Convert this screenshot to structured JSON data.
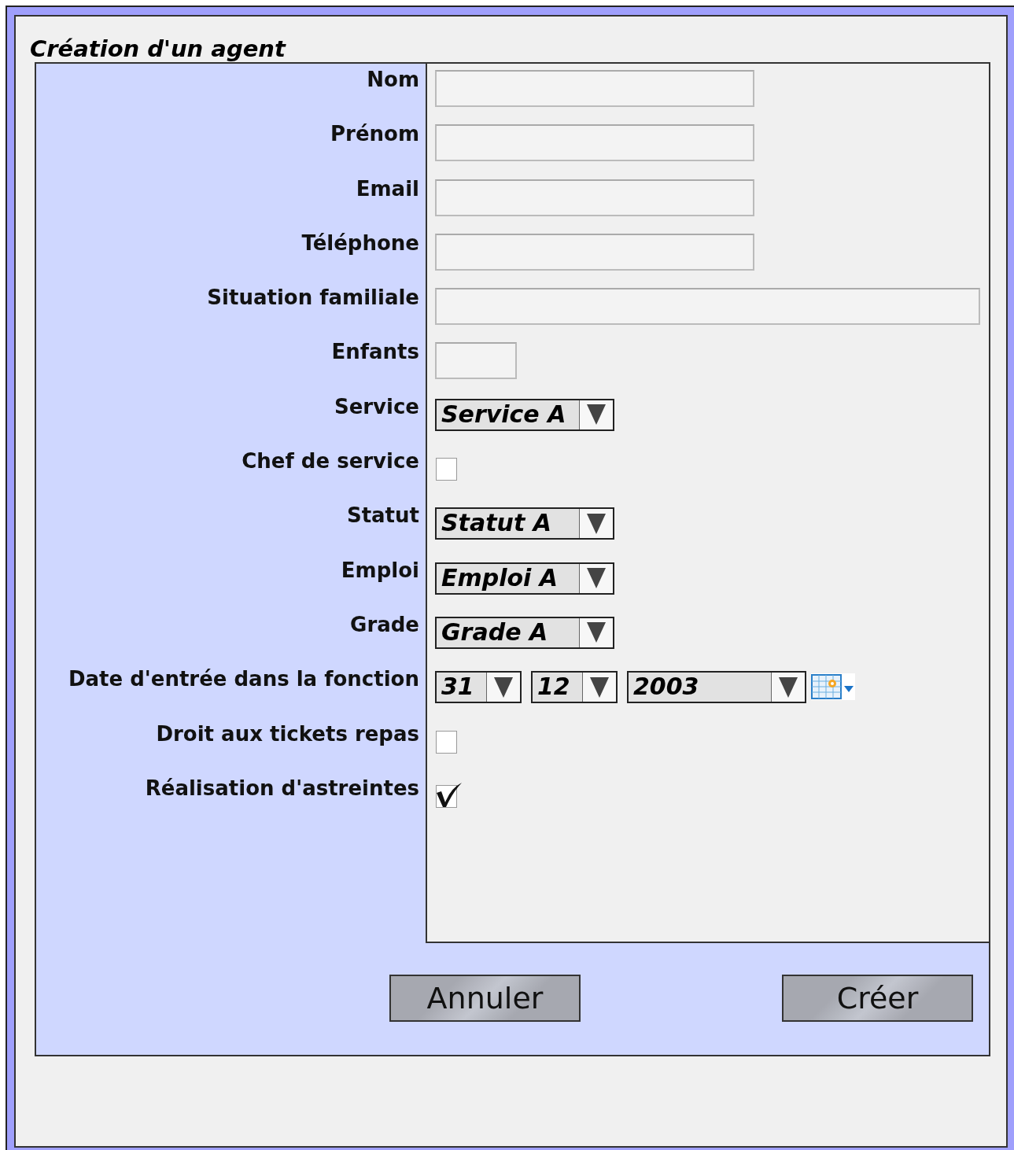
{
  "title": "Création d'un agent",
  "fields": [
    {
      "label": "Nom",
      "kind": "text"
    },
    {
      "label": "Prénom",
      "kind": "text"
    },
    {
      "label": "Email",
      "kind": "text"
    },
    {
      "label": "Téléphone",
      "kind": "text"
    },
    {
      "label": "Situation familiale",
      "kind": "long-text"
    },
    {
      "label": "Enfants",
      "kind": "short-text"
    },
    {
      "label": "Service",
      "kind": "select",
      "value": "Service A"
    },
    {
      "label": "Chef de service",
      "kind": "checkbox",
      "checked": false
    },
    {
      "label": "Statut",
      "kind": "select",
      "value": "Statut A"
    },
    {
      "label": "Emploi",
      "kind": "select",
      "value": "Emploi A"
    },
    {
      "label": "Grade",
      "kind": "select",
      "value": "Grade A"
    },
    {
      "label": "Date d'entrée dans la fonction",
      "kind": "date",
      "day": "31",
      "month": "12",
      "year": "2003"
    },
    {
      "label": "Droit aux tickets repas",
      "kind": "checkbox",
      "checked": false
    },
    {
      "label": "Réalisation d'astreintes",
      "kind": "checkbox",
      "checked": true
    }
  ],
  "buttons": [
    "Annuler",
    "Créer"
  ]
}
